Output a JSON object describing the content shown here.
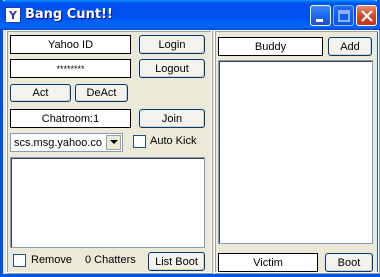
{
  "window": {
    "title": "Bang Cunt!!"
  },
  "login": {
    "yahoo_id_placeholder": "Yahoo ID",
    "password_mask": "********",
    "login_label": "Login",
    "logout_label": "Logout",
    "act_label": "Act",
    "deact_label": "DeAct"
  },
  "chat": {
    "chatroom_value": "Chatroom:1",
    "join_label": "Join",
    "server_selected": "scs.msg.yahoo.co",
    "auto_kick_label": "Auto Kick",
    "remove_label": "Remove",
    "chatters_count": "0 Chatters",
    "list_boot_label": "List Boot"
  },
  "buddy": {
    "buddy_value": "Buddy",
    "add_label": "Add",
    "victim_value": "Victim",
    "boot_label": "Boot"
  },
  "colors": {
    "titlebar": "#0054e3",
    "face": "#ece9d8"
  }
}
